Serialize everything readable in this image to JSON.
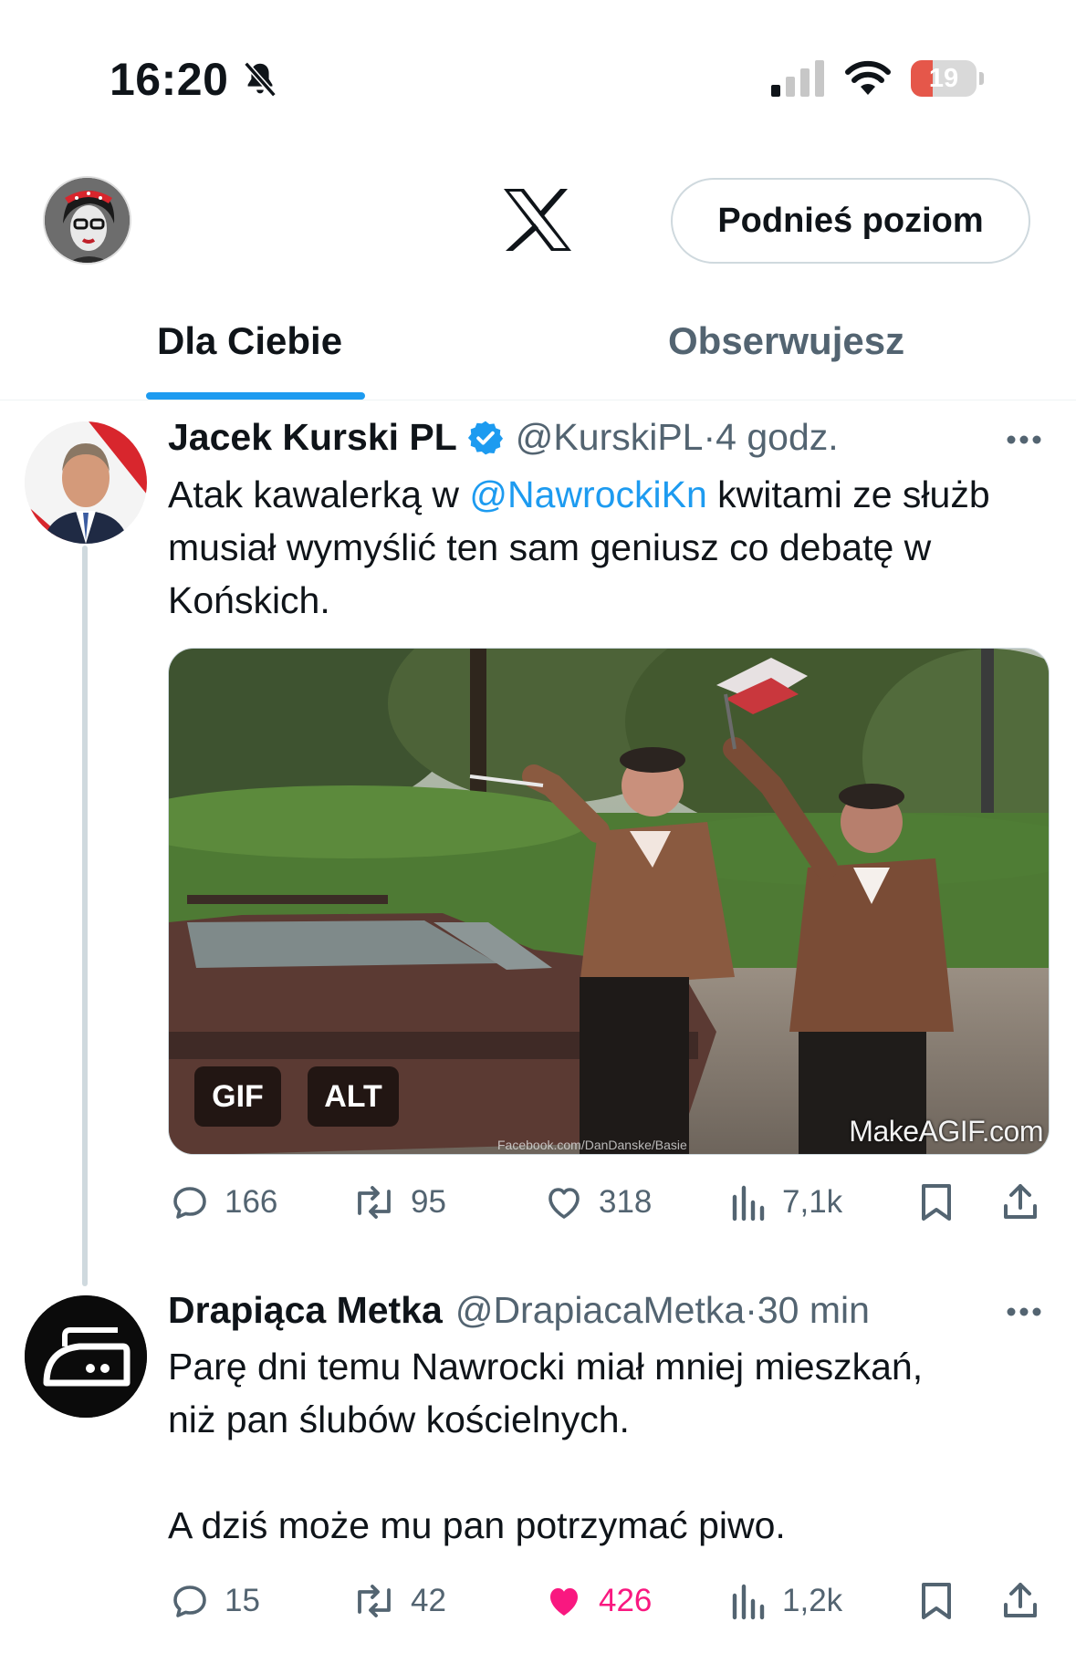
{
  "status_bar": {
    "time": "16:20",
    "battery": "19",
    "battery_level": 0.19
  },
  "header": {
    "upgrade_label": "Podnieś poziom",
    "logo": "x-logo"
  },
  "tabs": [
    {
      "label": "Dla Ciebie",
      "active": true
    },
    {
      "label": "Obserwujesz",
      "active": false
    }
  ],
  "tweets": [
    {
      "display_name": "Jacek Kurski PL",
      "verified": true,
      "handle": "@KurskiPL",
      "separator": "·",
      "time": "4 godz.",
      "text_before": "Atak kawalerką w ",
      "mention": "@NawrockiKn",
      "text_after": " kwitami ze służb musiał wymyślić ten sam geniusz co debatę w Końskich.",
      "media": {
        "badges": [
          "GIF",
          "ALT"
        ],
        "watermark": "MakeAGIF.com",
        "small_caption": "Facebook.com/DanDanske/Basie"
      },
      "stats": {
        "replies": "166",
        "reposts": "95",
        "likes": "318",
        "views": "7,1k"
      }
    },
    {
      "display_name": "Drapiąca Metka",
      "verified": false,
      "handle": "@DrapiacaMetka",
      "separator": "·",
      "time": "30 min",
      "line1": "Parę dni temu Nawrocki miał mniej mieszkań,",
      "line2": "niż pan ślubów kościelnych.",
      "line3": "A dziś może mu pan potrzymać piwo.",
      "stats": {
        "replies": "15",
        "reposts": "42",
        "likes": "426",
        "views": "1,2k"
      },
      "liked": true
    }
  ],
  "colors": {
    "accent": "#1d9bf0",
    "like": "#f91880",
    "muted": "#536471",
    "battery_low": "#e5574a"
  }
}
